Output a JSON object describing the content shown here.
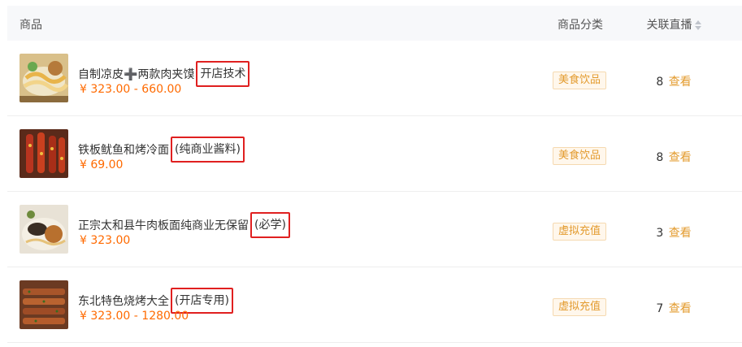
{
  "header": {
    "product": "商品",
    "category": "商品分类",
    "live": "关联直播"
  },
  "rows": [
    {
      "name": "自制凉皮➕两款肉夹馍",
      "highlight": "开店技术",
      "price": "¥ 323.00 - 660.00",
      "category": "美食饮品",
      "live_count": "8",
      "view": "查看",
      "thumb_icon": "liangpi-food-image"
    },
    {
      "name": "铁板鱿鱼和烤冷面",
      "highlight": "(纯商业酱料)",
      "price": "¥ 69.00",
      "category": "美食饮品",
      "live_count": "8",
      "view": "查看",
      "thumb_icon": "grilled-squid-image"
    },
    {
      "name": "正宗太和县牛肉板面纯商业无保留",
      "highlight": "(必学)",
      "price": "¥ 323.00",
      "category": "虚拟充值",
      "live_count": "3",
      "view": "查看",
      "thumb_icon": "beef-noodle-image"
    },
    {
      "name": "东北特色烧烤大全",
      "highlight": "(开店专用)",
      "price": "¥ 323.00 - 1280.00",
      "category": "虚拟充值",
      "live_count": "7",
      "view": "查看",
      "thumb_icon": "bbq-skewers-image"
    }
  ],
  "colors": {
    "price": "#ff6a00",
    "tag_text": "#e39b2e",
    "highlight_border": "#e02020"
  }
}
